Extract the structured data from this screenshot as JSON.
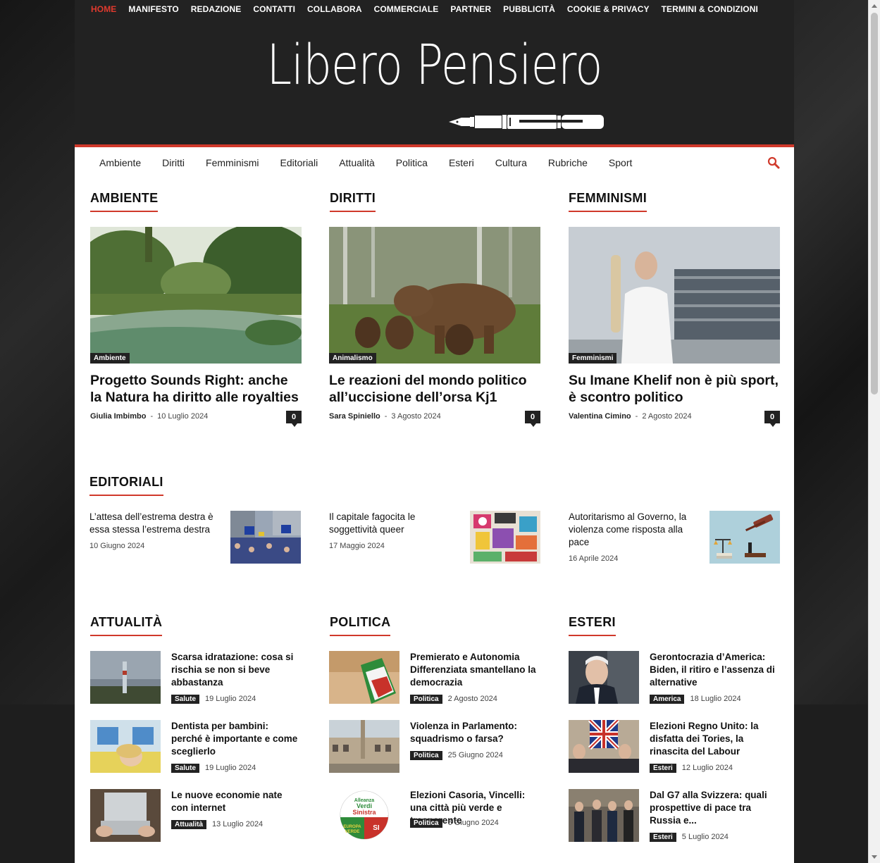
{
  "topnav": [
    "HOME",
    "MANIFESTO",
    "REDAZIONE",
    "CONTATTI",
    "COLLABORA",
    "COMMERCIALE",
    "PARTNER",
    "PUBBLICITÀ",
    "COOKIE & PRIVACY",
    "TERMINI & CONDIZIONI"
  ],
  "logo": "Libero Pensiero",
  "mainnav": [
    "Ambiente",
    "Diritti",
    "Femminismi",
    "Editoriali",
    "Attualità",
    "Politica",
    "Esteri",
    "Cultura",
    "Rubriche",
    "Sport"
  ],
  "sections": {
    "ambiente": "AMBIENTE",
    "diritti": "DIRITTI",
    "femminismi": "FEMMINISMI",
    "editoriali": "EDITORIALI",
    "attualita": "ATTUALITÀ",
    "politica": "POLITICA",
    "esteri": "ESTERI"
  },
  "cards": [
    {
      "category": "Ambiente",
      "title": "Progetto Sounds Right: anche la Natura ha diritto alle royalties",
      "author": "Giulia Imbimbo",
      "date": "10 Luglio 2024",
      "comments": "0"
    },
    {
      "category": "Animalismo",
      "title": "Le reazioni del mondo politico all’uccisione dell’orsa Kj1",
      "author": "Sara Spiniello",
      "date": "3 Agosto 2024",
      "comments": "0"
    },
    {
      "category": "Femminismi",
      "title": "Su Imane Khelif non è più sport, è scontro politico",
      "author": "Valentina Cimino",
      "date": "2 Agosto 2024",
      "comments": "0"
    }
  ],
  "editorials": [
    {
      "title": "L’attesa dell’estrema destra è essa stessa l’estrema destra",
      "date": "10 Giugno 2024"
    },
    {
      "title": "Il capitale fagocita le soggettività queer",
      "date": "17 Maggio 2024"
    },
    {
      "title": "Autoritarismo al Governo, la violenza come risposta alla pace",
      "date": "16 Aprile 2024"
    }
  ],
  "attualita": [
    {
      "title": "Scarsa idratazione: cosa si rischia se non si beve abbastanza",
      "tag": "Salute",
      "date": "19 Luglio 2024"
    },
    {
      "title": "Dentista per bambini: perché è importante e come sceglierlo",
      "tag": "Salute",
      "date": "19 Luglio 2024"
    },
    {
      "title": "Le nuove economie nate con internet",
      "tag": "Attualità",
      "date": "13 Luglio 2024"
    }
  ],
  "politica": [
    {
      "title": "Premierato e Autonomia Differenziata smantellano la democrazia",
      "tag": "Politica",
      "date": "2 Agosto 2024"
    },
    {
      "title": "Violenza in Parlamento: squadrismo o farsa?",
      "tag": "Politica",
      "date": "25 Giugno 2024"
    },
    {
      "title": "Elezioni Casoria, Vincelli: una città più verde e trasparente",
      "tag": "Politica",
      "date": "6 Giugno 2024"
    }
  ],
  "esteri": [
    {
      "title": "Gerontocrazia d’America: Biden, il ritiro e l’assenza di alternative",
      "tag": "America",
      "date": "18 Luglio 2024"
    },
    {
      "title": "Elezioni Regno Unito: la disfatta dei Tories, la rinascita del Labour",
      "tag": "Esteri",
      "date": "12 Luglio 2024"
    },
    {
      "title": "Dal G7 alla Svizzera: quali prospettive di pace tra Russia e...",
      "tag": "Esteri",
      "date": "5 Luglio 2024"
    }
  ],
  "logo_badge": {
    "l1": "Alleanza",
    "l2": "Verdi",
    "l3": "Sinistra",
    "l4": "EUROPA",
    "l5": "VERDE",
    "l6": "SI"
  },
  "colors": {
    "accent": "#d0392b",
    "header_bg": "#222222",
    "tag_bg": "#222222"
  }
}
